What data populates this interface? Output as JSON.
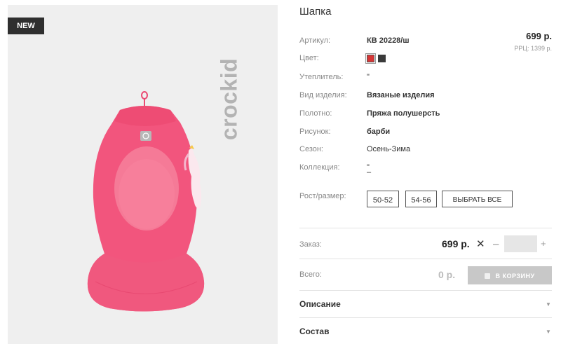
{
  "badge": "NEW",
  "brand": "crockid",
  "product": {
    "title": "Шапка",
    "price": "699 р.",
    "rrp": "РРЦ: 1399 р."
  },
  "specs": {
    "article_label": "Артикул:",
    "article_value": "КВ 20228/ш",
    "color_label": "Цвет:",
    "colors": [
      "#d73535",
      "#3a3a3a"
    ],
    "insulation_label": "Утеплитель:",
    "insulation_value": "\"",
    "type_label": "Вид изделия:",
    "type_value": "Вязаные изделия",
    "fabric_label": "Полотно:",
    "fabric_value": "Пряжа полушерсть",
    "pattern_label": "Рисунок:",
    "pattern_value": "барби",
    "season_label": "Сезон:",
    "season_value": "Осень-Зима",
    "collection_label": "Коллекция:",
    "collection_value_1": "\"",
    "collection_value_2": "–"
  },
  "sizes": {
    "label": "Рост/размер:",
    "options": [
      "50-52",
      "54-56"
    ],
    "select_all": "ВЫБРАТЬ ВСЕ"
  },
  "order": {
    "label": "Заказ:",
    "price": "699 р.",
    "times": "✕",
    "minus": "–",
    "plus": "+",
    "quantity": ""
  },
  "total": {
    "label": "Всего:",
    "value": "0 р.",
    "cart_button": "В КОРЗИНУ"
  },
  "accordion": {
    "description": "Описание",
    "composition": "Состав"
  }
}
